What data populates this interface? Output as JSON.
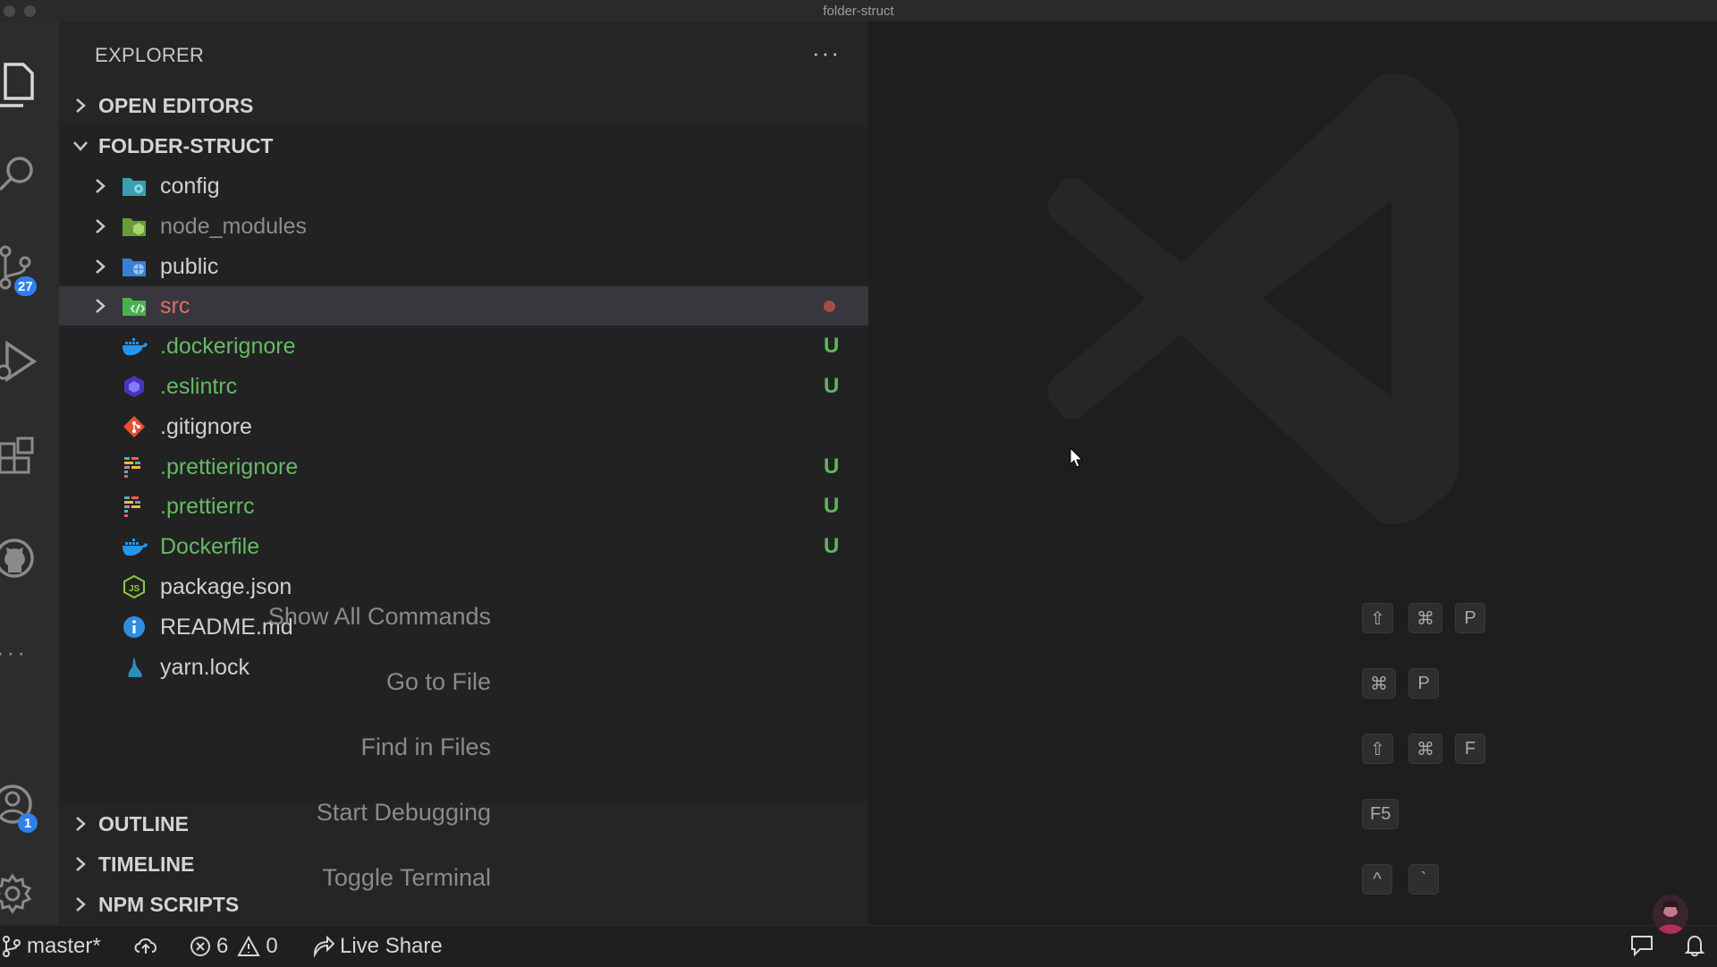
{
  "window": {
    "title": "folder-struct"
  },
  "activity_bar": {
    "source_control_badge": "27",
    "accounts_badge": "1"
  },
  "explorer": {
    "title": "EXPLORER",
    "more_label": "···",
    "open_editors_label": "OPEN EDITORS",
    "folder_label": "FOLDER-STRUCT",
    "items": [
      {
        "name": "config",
        "type": "folder",
        "icon": "folder-config-icon",
        "status": ""
      },
      {
        "name": "node_modules",
        "type": "folder",
        "icon": "folder-node-icon",
        "status": ""
      },
      {
        "name": "public",
        "type": "folder",
        "icon": "folder-public-icon",
        "status": ""
      },
      {
        "name": "src",
        "type": "folder",
        "icon": "folder-src-icon",
        "status": "●"
      },
      {
        "name": ".dockerignore",
        "type": "file",
        "icon": "docker-icon",
        "status": "U"
      },
      {
        "name": ".eslintrc",
        "type": "file",
        "icon": "eslint-icon",
        "status": "U"
      },
      {
        "name": ".gitignore",
        "type": "file",
        "icon": "git-icon",
        "status": ""
      },
      {
        "name": ".prettierignore",
        "type": "file",
        "icon": "prettier-icon",
        "status": "U"
      },
      {
        "name": ".prettierrc",
        "type": "file",
        "icon": "prettier-icon",
        "status": "U"
      },
      {
        "name": "Dockerfile",
        "type": "file",
        "icon": "docker-icon",
        "status": "U"
      },
      {
        "name": "package.json",
        "type": "file",
        "icon": "nodejs-icon",
        "status": ""
      },
      {
        "name": "README.md",
        "type": "file",
        "icon": "info-icon",
        "status": ""
      },
      {
        "name": "yarn.lock",
        "type": "file",
        "icon": "yarn-icon",
        "status": ""
      }
    ],
    "outline_label": "OUTLINE",
    "timeline_label": "TIMELINE",
    "npm_scripts_label": "NPM SCRIPTS"
  },
  "welcome": {
    "shortcuts": [
      {
        "label": "Show All Commands",
        "keys": [
          "⇧",
          "⌘",
          "P"
        ]
      },
      {
        "label": "Go to File",
        "keys": [
          "⌘",
          "P"
        ]
      },
      {
        "label": "Find in Files",
        "keys": [
          "⇧",
          "⌘",
          "F"
        ]
      },
      {
        "label": "Start Debugging",
        "keys": [
          "F5"
        ]
      },
      {
        "label": "Toggle Terminal",
        "keys": [
          "^",
          "`"
        ]
      }
    ]
  },
  "status_bar": {
    "branch": "master*",
    "errors": "6",
    "warnings": "0",
    "live_share": "Live Share"
  },
  "colors": {
    "accent_badge": "#2f80ed",
    "untracked_green": "#5db85d",
    "error_red": "#e06c6c"
  }
}
